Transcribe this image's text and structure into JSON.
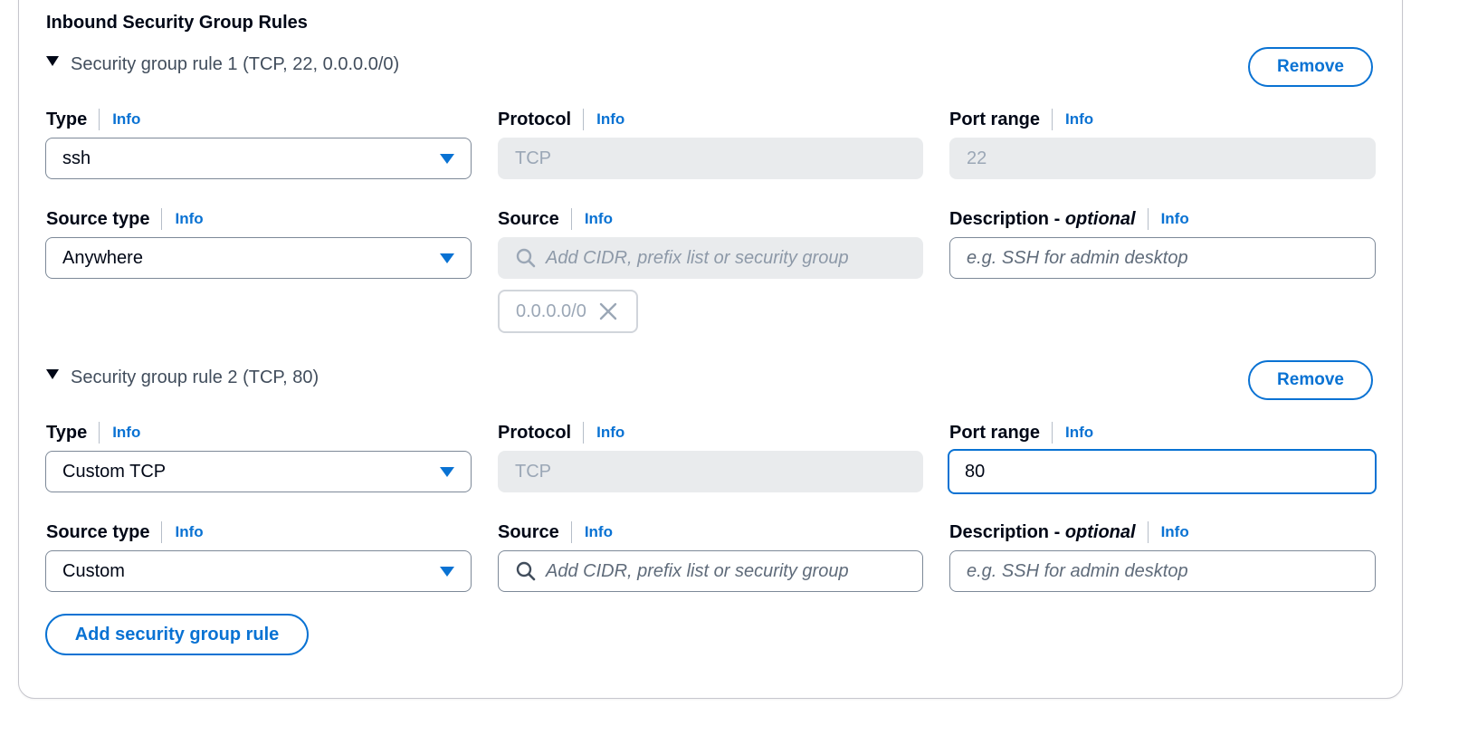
{
  "section": {
    "title": "Inbound Security Group Rules"
  },
  "common": {
    "info": "Info",
    "remove": "Remove",
    "type_label": "Type",
    "protocol_label": "Protocol",
    "port_range_label": "Port range",
    "source_type_label": "Source type",
    "source_label": "Source",
    "description_label": "Description -",
    "description_optional": "optional",
    "source_placeholder": "Add CIDR, prefix list or security group",
    "description_placeholder": "e.g. SSH for admin desktop"
  },
  "rules": [
    {
      "header": "Security group rule 1 (TCP, 22, 0.0.0.0/0)",
      "type": "ssh",
      "protocol": "TCP",
      "port_range": "22",
      "source_type": "Anywhere",
      "source_token": "0.0.0.0/0"
    },
    {
      "header": "Security group rule 2 (TCP, 80)",
      "type": "Custom TCP",
      "protocol": "TCP",
      "port_range": "80",
      "source_type": "Custom"
    }
  ],
  "add_rule_button": "Add security group rule",
  "colors": {
    "accent": "#0972d3",
    "text": "#000716",
    "disabled_bg": "#e9ebed"
  },
  "icons": [
    "caret-down-icon",
    "dropdown-arrow-icon",
    "search-icon",
    "close-icon"
  ]
}
